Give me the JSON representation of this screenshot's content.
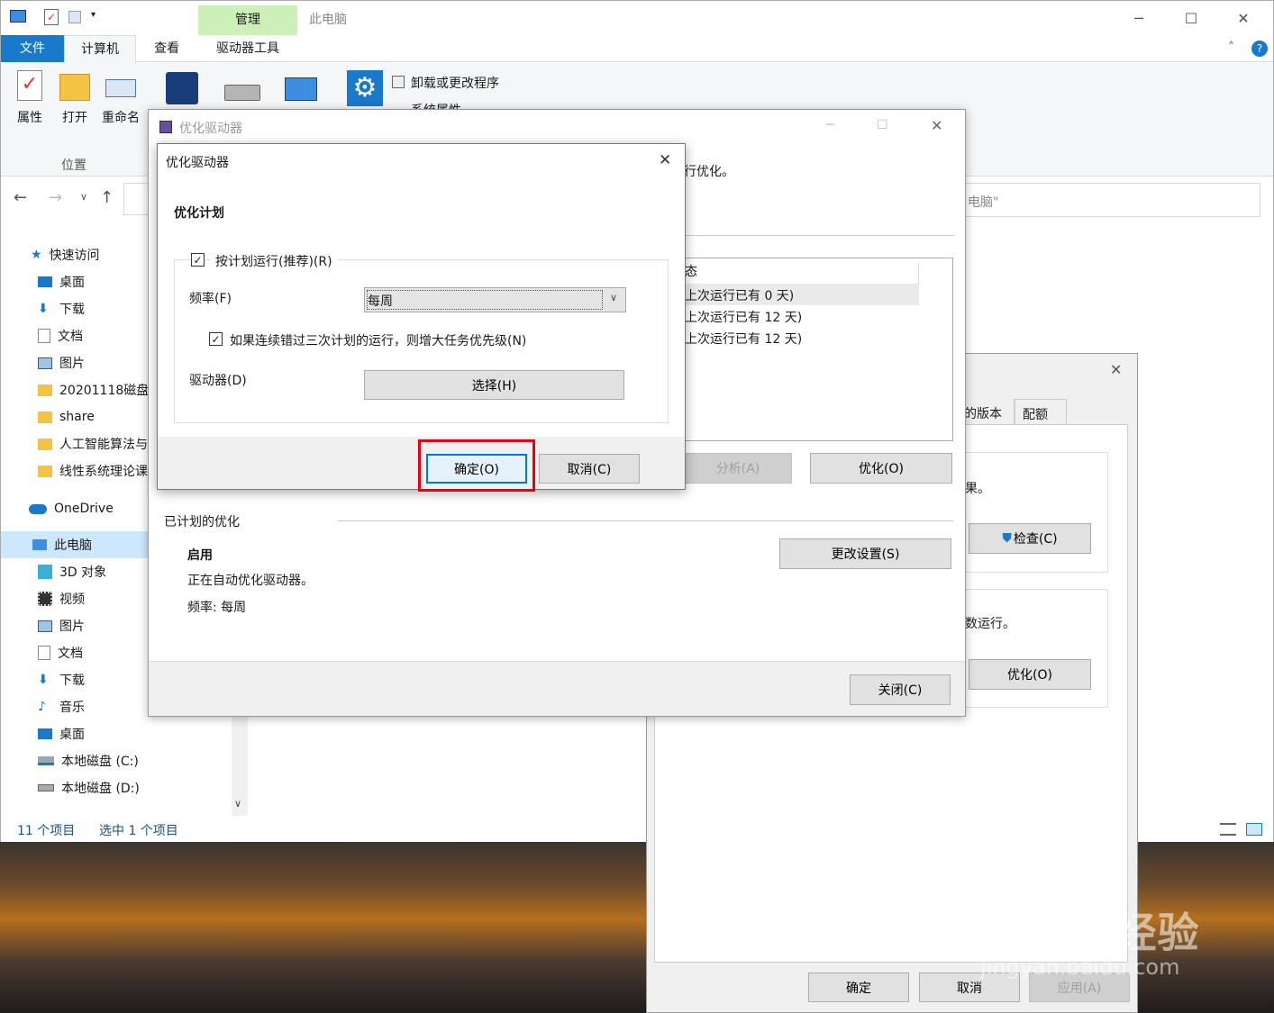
{
  "explorer": {
    "window_title": "此电脑",
    "context_tab": "管理",
    "tabs": [
      {
        "label": "文件"
      },
      {
        "label": "计算机"
      },
      {
        "label": "查看"
      },
      {
        "label": "驱动器工具"
      }
    ],
    "ribbon": {
      "properties": "属性",
      "open": "打开",
      "rename": "重命名",
      "group_location": "位置",
      "uninstall": "卸载或更改程序",
      "system_props": "系统属性"
    },
    "address_partial": "电脑\"",
    "nav": [
      {
        "label": "快速访问",
        "icon": "star-icon"
      },
      {
        "label": "桌面",
        "icon": "desktop-icon"
      },
      {
        "label": "下载",
        "icon": "download-icon"
      },
      {
        "label": "文档",
        "icon": "document-icon"
      },
      {
        "label": "图片",
        "icon": "picture-icon"
      },
      {
        "label": "20201118磁盘",
        "icon": "folder-icon"
      },
      {
        "label": "share",
        "icon": "folder-icon"
      },
      {
        "label": "人工智能算法与",
        "icon": "folder-icon"
      },
      {
        "label": "线性系统理论课",
        "icon": "folder-icon"
      },
      {
        "label": "OneDrive",
        "icon": "cloud-icon"
      },
      {
        "label": "此电脑",
        "icon": "computer-icon"
      },
      {
        "label": "3D 对象",
        "icon": "cube-icon"
      },
      {
        "label": "视频",
        "icon": "video-icon"
      },
      {
        "label": "图片",
        "icon": "picture-icon"
      },
      {
        "label": "文档",
        "icon": "document-icon"
      },
      {
        "label": "下载",
        "icon": "download-icon"
      },
      {
        "label": "音乐",
        "icon": "music-icon"
      },
      {
        "label": "桌面",
        "icon": "desktop-icon"
      },
      {
        "label": "本地磁盘 (C:)",
        "icon": "drive-c-icon"
      },
      {
        "label": "本地磁盘 (D:)",
        "icon": "drive-d-icon"
      }
    ],
    "status_items": "11 个项目",
    "status_selected": "选中 1 个项目"
  },
  "properties_dialog": {
    "tab_versions": "的版本",
    "tab_quota": "配额",
    "text1": "果。",
    "check_button": "检查(C)",
    "text2": "数运行。",
    "optimize_button": "优化(O)",
    "ok": "确定",
    "cancel": "取消",
    "apply": "应用(A)"
  },
  "optimize_window": {
    "title": "优化驱动器",
    "partial_text": "行优化。",
    "list_header": "态",
    "list_rows": [
      "上次运行已有 0 天)",
      "上次运行已有 12 天)",
      "上次运行已有 12 天)"
    ],
    "analyze": "分析(A)",
    "optimize": "优化(O)",
    "scheduled_title": "已计划的优化",
    "status_on": "启用",
    "auto_text": "正在自动优化驱动器。",
    "freq_text": "频率: 每周",
    "change_settings": "更改设置(S)",
    "close": "关闭(C)"
  },
  "schedule_dialog": {
    "title": "优化驱动器",
    "section": "优化计划",
    "run_on_schedule": "按计划运行(推荐)(R)",
    "frequency_label": "频率(F)",
    "frequency_value": "每周",
    "increase_priority": "如果连续错过三次计划的运行，则增大任务优先级(N)",
    "drives_label": "驱动器(D)",
    "choose": "选择(H)",
    "ok": "确定(O)",
    "cancel": "取消(C)"
  },
  "watermark": {
    "brand": "Baidu经验",
    "url": "jingyan.baidu.com"
  },
  "colors": {
    "accent": "#0078d7",
    "highlight": "#e60012",
    "ribbon_tab_context": "#ccf0b7"
  }
}
